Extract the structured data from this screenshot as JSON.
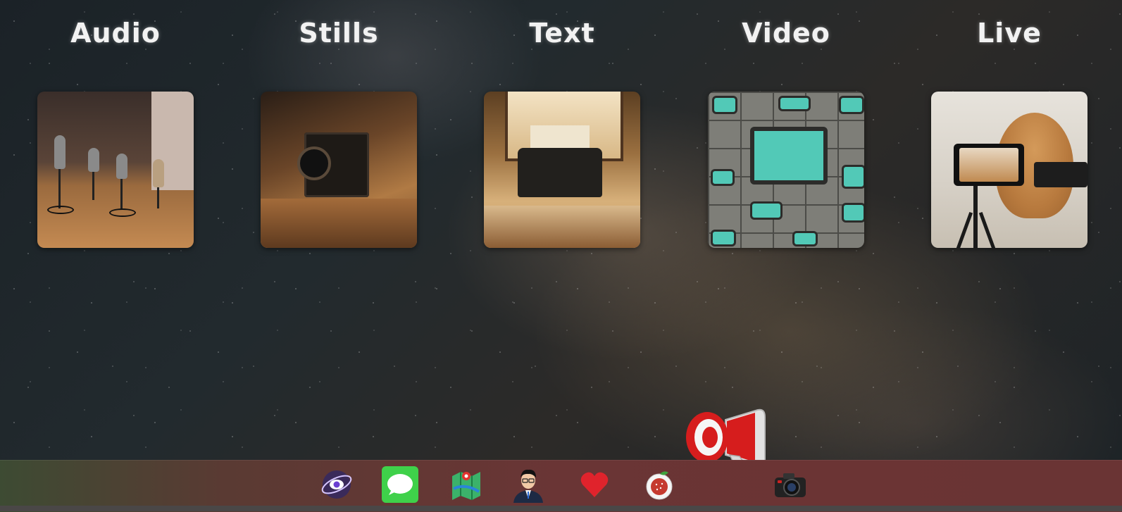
{
  "categories": [
    {
      "title": "Audio",
      "icon": "podcast-microphones-image"
    },
    {
      "title": "Stills",
      "icon": "vintage-camera-image"
    },
    {
      "title": "Text",
      "icon": "typewriter-image"
    },
    {
      "title": "Video",
      "icon": "retro-televisions-image"
    },
    {
      "title": "Live",
      "icon": "dog-livestream-image"
    }
  ],
  "overlay_icon": "megaphone-icon",
  "dock": {
    "items": [
      {
        "icon": "eye-orbit-icon"
      },
      {
        "icon": "messages-icon"
      },
      {
        "icon": "maps-icon"
      },
      {
        "icon": "avatar-icon"
      },
      {
        "icon": "heart-icon"
      },
      {
        "icon": "apple-icon"
      },
      {
        "icon": "camera-icon"
      }
    ]
  },
  "colors": {
    "title": "#f2f2f2",
    "dock": "#6a3535",
    "messages_green": "#3fd14a",
    "megaphone_red": "#d91e1e"
  }
}
